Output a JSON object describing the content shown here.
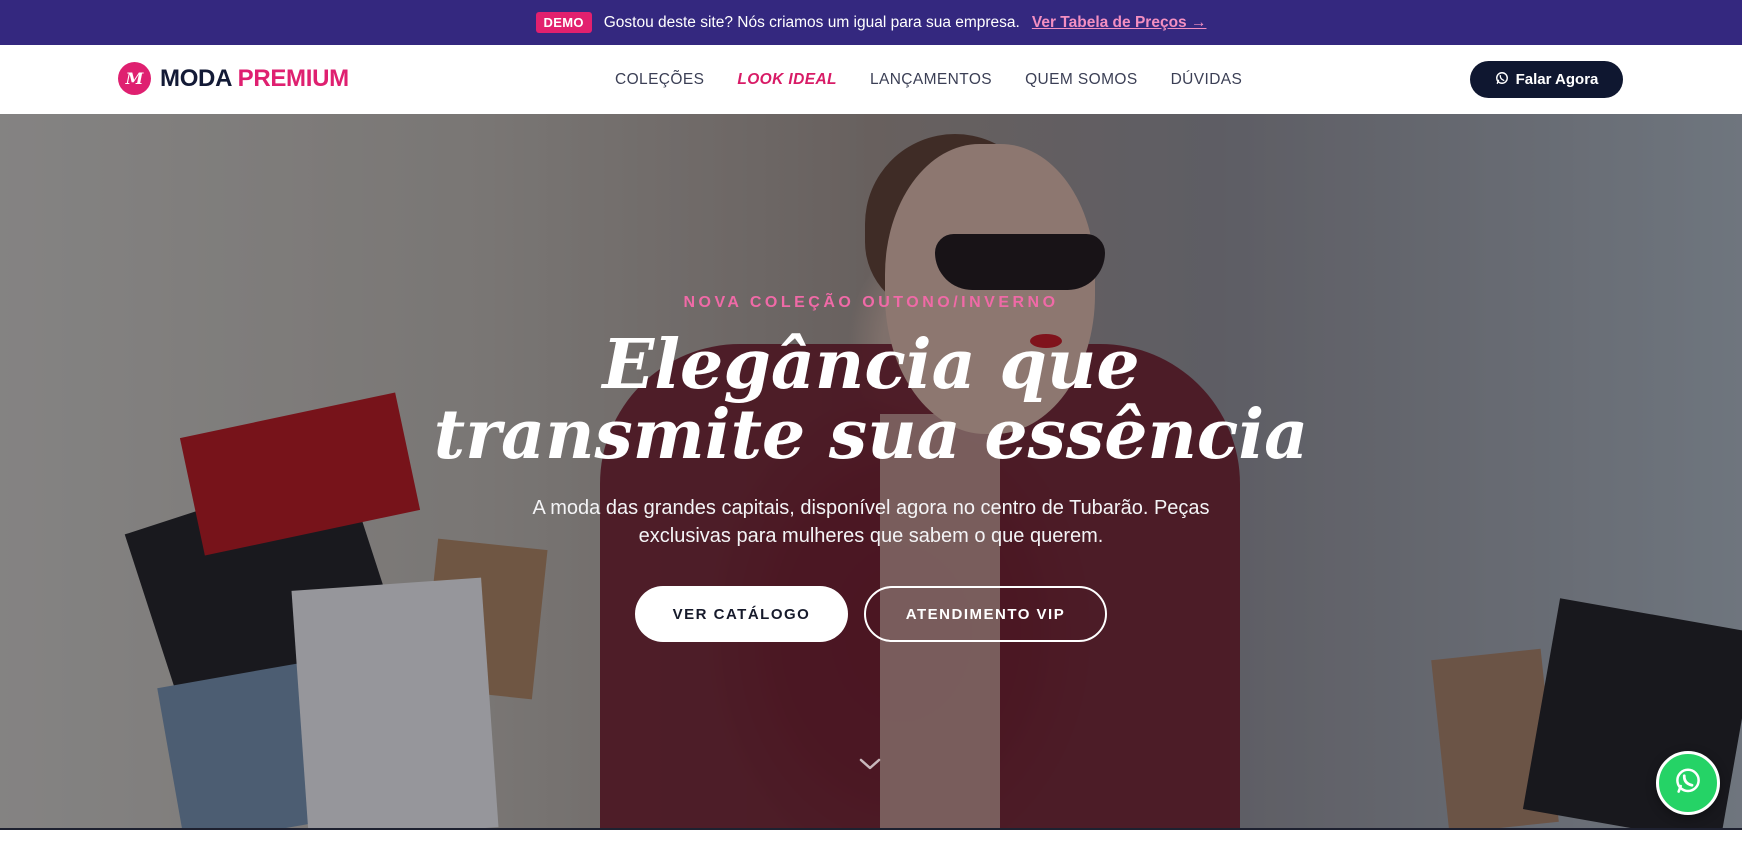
{
  "demo_bar": {
    "badge": "DEMO",
    "text": "Gostou deste site? Nós criamos um igual para sua empresa.",
    "link": "Ver Tabela de Preços →"
  },
  "header": {
    "logo_mark": "M",
    "logo_word1": "MODA",
    "logo_word2": "PREMIUM",
    "nav": [
      {
        "label": "COLEÇÕES"
      },
      {
        "label": "LOOK IDEAL"
      },
      {
        "label": "LANÇAMENTOS"
      },
      {
        "label": "QUEM SOMOS"
      },
      {
        "label": "DÚVIDAS"
      }
    ],
    "active_nav": "LOOK IDEAL",
    "cta_label": "Falar Agora",
    "cta_icon": "whatsapp-icon"
  },
  "hero": {
    "eyebrow": "NOVA COLEÇÃO OUTONO/INVERNO",
    "headline_line1": "Elegância que",
    "headline_line2": "transmite sua essência",
    "subtext": "A moda das grandes capitais, disponível agora no centro de Tubarão. Peças exclusivas para mulheres que sabem o que querem.",
    "primary_button": "VER CATÁLOGO",
    "secondary_button": "ATENDIMENTO VIP",
    "scroll_icon": "chevron-down-icon"
  },
  "floating": {
    "icon": "whatsapp-icon"
  },
  "colors": {
    "demo_bar_bg": "#34287f",
    "accent_pink": "#df2070",
    "navy": "#0f1730",
    "whatsapp_green": "#25d366"
  }
}
